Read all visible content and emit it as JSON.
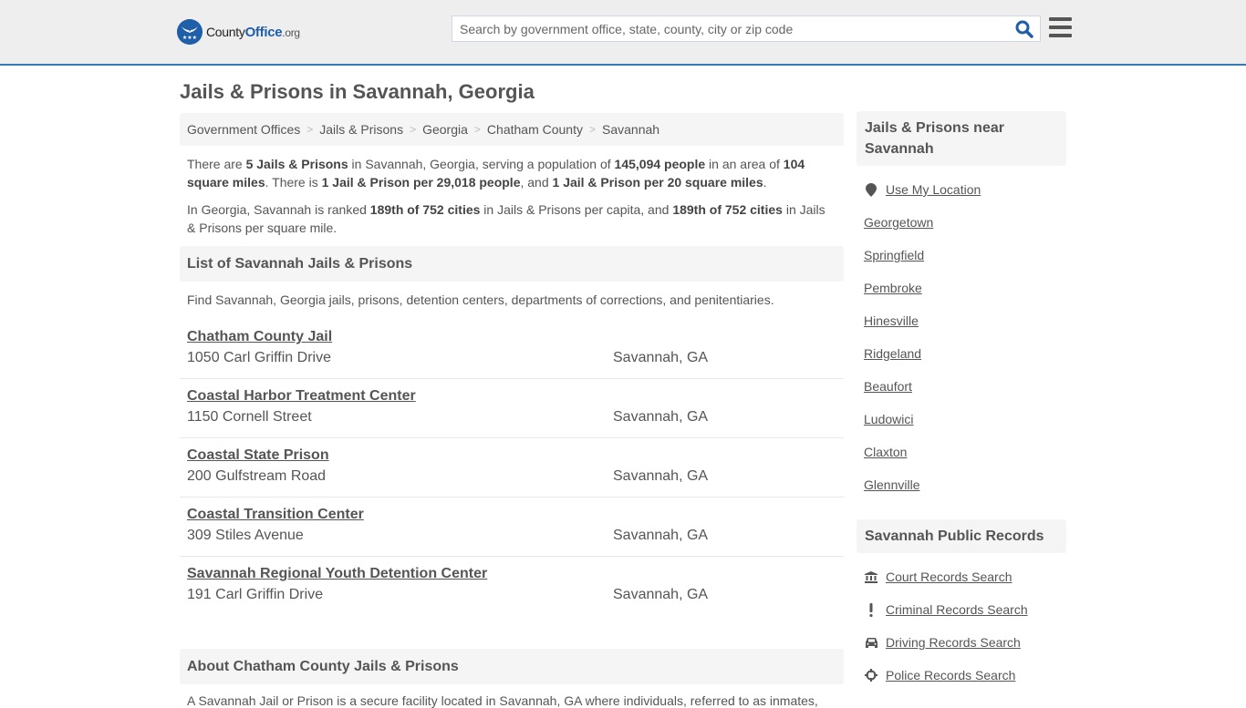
{
  "header": {
    "logo": {
      "county": "County",
      "office": "Office",
      "org": ".org"
    },
    "search": {
      "placeholder": "Search by government office, state, county, city or zip code",
      "value": ""
    },
    "accent_color": "#337ab7",
    "brand_color": "#1f5ea8"
  },
  "page": {
    "title": "Jails & Prisons in Savannah, Georgia"
  },
  "breadcrumb": [
    {
      "label": "Government Offices"
    },
    {
      "label": "Jails & Prisons"
    },
    {
      "label": "Georgia"
    },
    {
      "label": "Chatham County"
    },
    {
      "label": "Savannah"
    }
  ],
  "intro": {
    "p1": {
      "t1": "There are ",
      "b1": "5 Jails & Prisons",
      "t2": " in Savannah, Georgia, serving a population of ",
      "b2": "145,094 people",
      "t3": " in an area of ",
      "b3": "104 square miles",
      "t4": ". There is ",
      "b4": "1 Jail & Prison per 29,018 people",
      "t5": ", and ",
      "b5": "1 Jail & Prison per 20 square miles",
      "t6": "."
    },
    "p2": {
      "t1": "In Georgia, Savannah is ranked ",
      "b1": "189th of 752 cities",
      "t2": " in Jails & Prisons per capita, and ",
      "b2": "189th of 752 cities",
      "t3": " in Jails & Prisons per square mile."
    }
  },
  "list": {
    "heading": "List of Savannah Jails & Prisons",
    "description": "Find Savannah, Georgia jails, prisons, detention centers, departments of corrections, and penitentiaries.",
    "items": [
      {
        "name": "Chatham County Jail",
        "address": "1050 Carl Griffin Drive",
        "city": "Savannah, GA"
      },
      {
        "name": "Coastal Harbor Treatment Center",
        "address": "1150 Cornell Street",
        "city": "Savannah, GA"
      },
      {
        "name": "Coastal State Prison",
        "address": "200 Gulfstream Road",
        "city": "Savannah, GA"
      },
      {
        "name": "Coastal Transition Center",
        "address": "309 Stiles Avenue",
        "city": "Savannah, GA"
      },
      {
        "name": "Savannah Regional Youth Detention Center",
        "address": "191 Carl Griffin Drive",
        "city": "Savannah, GA"
      }
    ]
  },
  "about": {
    "heading": "About Chatham County Jails & Prisons",
    "text": "A Savannah Jail or Prison is a secure facility located in Savannah, GA where individuals, referred to as inmates,"
  },
  "sidebar": {
    "nearby": {
      "heading": "Jails & Prisons near Savannah",
      "use_location": "Use My Location",
      "cities": [
        "Georgetown",
        "Springfield",
        "Pembroke",
        "Hinesville",
        "Ridgeland",
        "Beaufort",
        "Ludowici",
        "Claxton",
        "Glennville"
      ]
    },
    "records": {
      "heading": "Savannah Public Records",
      "items": [
        {
          "label": "Court Records Search",
          "icon": "courthouse-icon"
        },
        {
          "label": "Criminal Records Search",
          "icon": "exclamation-icon"
        },
        {
          "label": "Driving Records Search",
          "icon": "car-icon"
        },
        {
          "label": "Police Records Search",
          "icon": "crosshair-icon"
        }
      ]
    }
  }
}
